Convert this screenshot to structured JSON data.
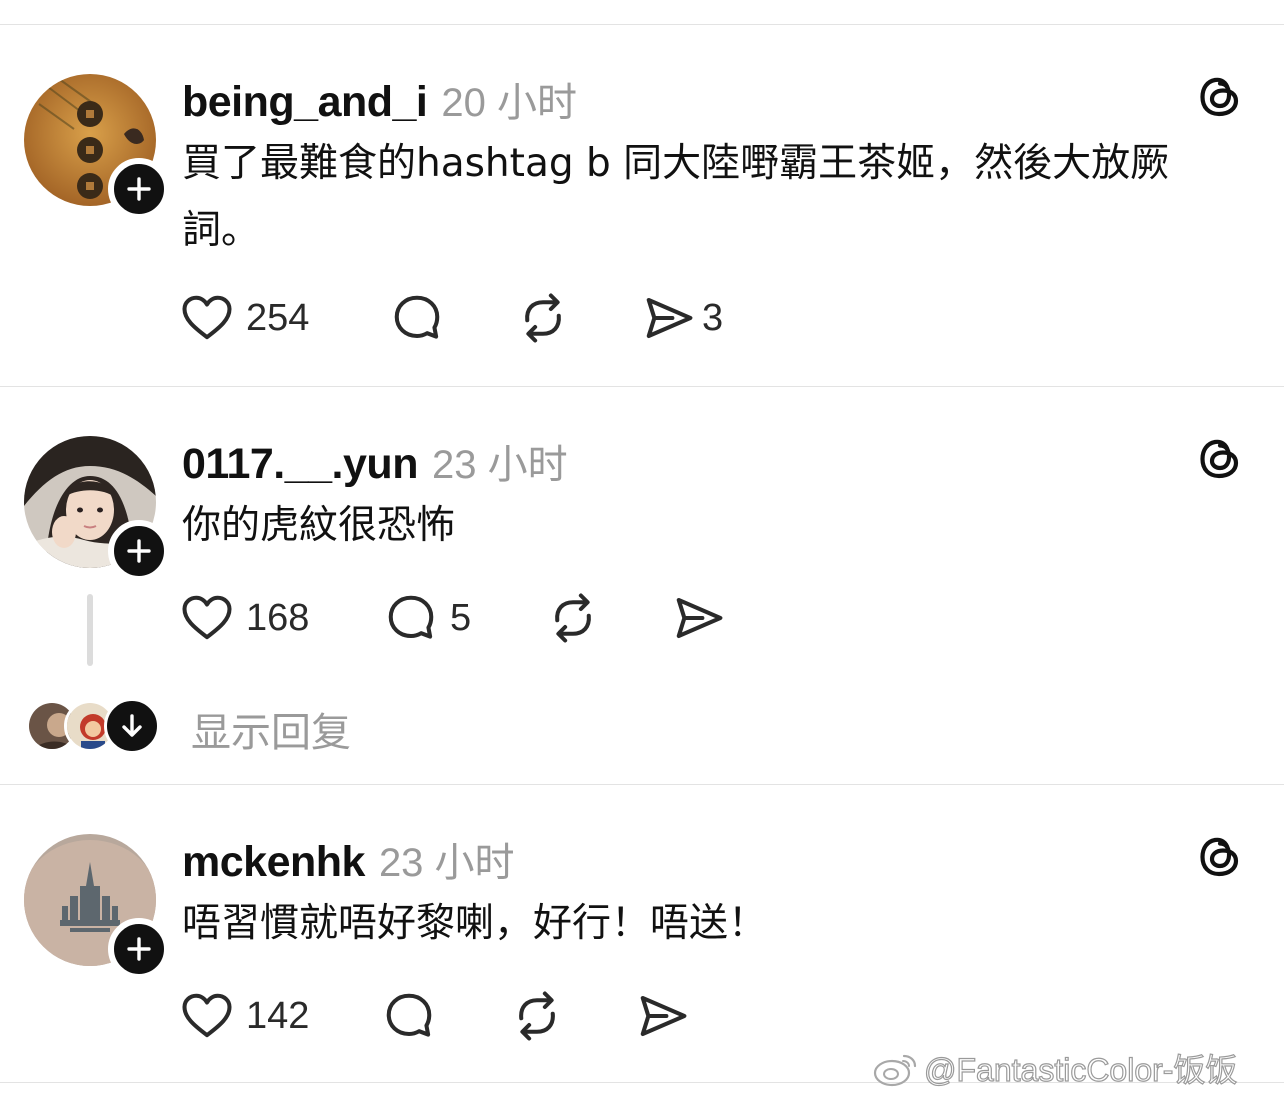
{
  "posts": [
    {
      "username": "being_and_i",
      "time": "20 小时",
      "content": "買了最難食的hashtag b 同大陸嘢霸王茶姬，然後大放厥詞。",
      "likes": "254",
      "comments": "",
      "reposts": "",
      "shares": "3"
    },
    {
      "username": "0117.__.yun",
      "time": "23 小时",
      "content": "你的虎紋很恐怖",
      "likes": "168",
      "comments": "5",
      "reposts": "",
      "shares": ""
    },
    {
      "username": "mckenhk",
      "time": "23 小时",
      "content": "唔習慣就唔好黎喇，好行！唔送！",
      "likes": "142",
      "comments": "",
      "reposts": "",
      "shares": ""
    }
  ],
  "show_replies_label": "显示回复",
  "watermark": "@FantasticColor-饭饭",
  "icons": {
    "like": "heart-icon",
    "comment": "comment-bubble-icon",
    "repost": "repost-icon",
    "share": "send-icon",
    "threads": "threads-logo-icon",
    "follow": "plus-icon",
    "expand": "arrow-down-icon"
  }
}
